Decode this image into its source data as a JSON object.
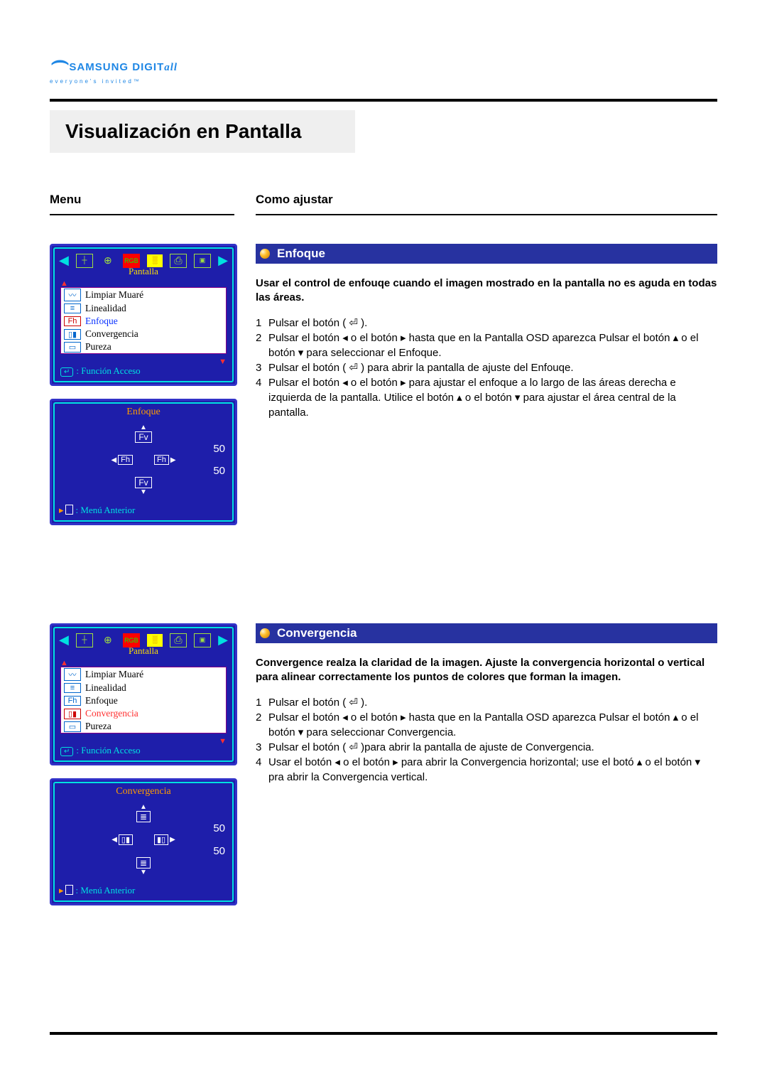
{
  "brand": {
    "name_pre": "SAMSUNG DIGIT",
    "name_post": "all",
    "tagline": "everyone's invited™"
  },
  "page": {
    "title": "Visualización en Pantalla",
    "menu_heading": "Menu",
    "howto_heading": "Como ajustar"
  },
  "osd": {
    "screen_crumb": "Pantalla",
    "access_label": "Función Acceso",
    "prev_menu": "Menú Anterior",
    "items": [
      {
        "icon": "〰",
        "label": "Limpiar Muaré"
      },
      {
        "icon": "≡",
        "label": "Linealidad"
      },
      {
        "icon": "Fh",
        "label": "Enfoque"
      },
      {
        "icon": "▯▮",
        "label": "Convergencia"
      },
      {
        "icon": "▭",
        "label": "Pureza"
      }
    ],
    "adjust": {
      "v1": "50",
      "v2": "50",
      "fv": "Fv",
      "fh": "Fh"
    }
  },
  "sections": {
    "enfoque": {
      "title": "Enfoque",
      "lead": "Usar el control de enfouqe cuando el imagen mostrado en la pantalla no es aguda en todas las áreas.",
      "osd_subtitle": "Enfoque",
      "steps": [
        "Pulsar el botón ( ⏎ ).",
        "Pulsar el botón ◂ o el botón ▸ hasta que en la Pantalla OSD aparezca Pulsar el botón ▴ o el botón ▾ para seleccionar el Enfoque.",
        "Pulsar el botón ( ⏎ ) para abrir la pantalla de ajuste del Enfouqe.",
        "Pulsar el botón ◂ o el botón ▸ para ajustar el enfoque a lo largo de las áreas derecha e izquierda de la pantalla. Utilice el botón ▴ o el botón ▾ para ajustar el área central de la pantalla."
      ]
    },
    "convergencia": {
      "title": "Convergencia",
      "lead": "Convergence realza la claridad de la imagen. Ajuste la convergencia horizontal o vertical para alinear correctamente los puntos de colores que forman la imagen.",
      "osd_subtitle": "Convergencia",
      "steps": [
        "Pulsar el botón ( ⏎ ).",
        "Pulsar el botón ◂ o el botón ▸ hasta que en la Pantalla OSD aparezca Pulsar el botón ▴ o el botón ▾ para seleccionar Convergencia.",
        "Pulsar el botón ( ⏎ )para abrir la pantalla de ajuste de Convergencia.",
        "Usar el botón ◂ o el botón ▸ para abrir la Convergencia horizontal; use el botó ▴ o el botón ▾ pra abrir la Convergencia vertical."
      ]
    }
  }
}
